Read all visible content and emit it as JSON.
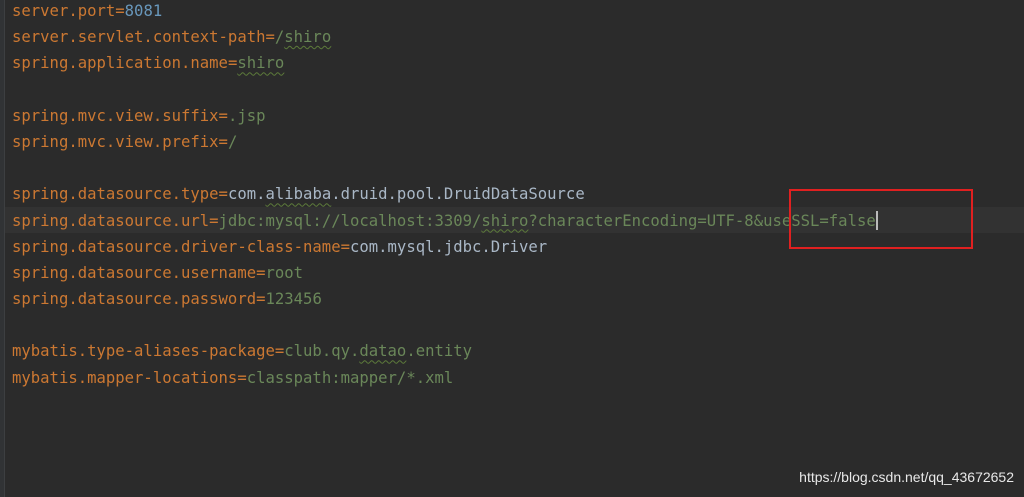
{
  "editor": {
    "lines": [
      {
        "key": "server.port",
        "eq": "=",
        "value": "8081",
        "type": "number"
      },
      {
        "key": "server.servlet.context-path",
        "eq": "=",
        "value_prefix": "/",
        "value_spell": "shiro",
        "type": "green"
      },
      {
        "key": "spring.application.name",
        "eq": "=",
        "value_spell": "shiro",
        "type": "green"
      },
      {
        "key": "spring.mvc.view.suffix",
        "eq": "=",
        "value": ".jsp",
        "type": "green"
      },
      {
        "key": "spring.mvc.view.prefix",
        "eq": "=",
        "value": "/",
        "type": "green"
      },
      {
        "key": "spring.datasource.type",
        "eq": "=",
        "value_a": "com.",
        "value_spell": "alibaba",
        "value_b": ".druid.pool.DruidDataSource",
        "type": "plain"
      },
      {
        "key": "spring.datasource.url",
        "eq": "=",
        "value_a": "jdbc:mysql://localhost:3309/",
        "value_spell": "shiro",
        "value_b": "?characterEncoding=UTF-8&useSSL=false",
        "type": "green"
      },
      {
        "key": "spring.datasource.driver-class-name",
        "eq": "=",
        "value": "com.mysql.jdbc.Driver",
        "type": "plain"
      },
      {
        "key": "spring.datasource.username",
        "eq": "=",
        "value": "root",
        "type": "green"
      },
      {
        "key": "spring.datasource.password",
        "eq": "=",
        "value": "123456",
        "type": "green"
      },
      {
        "key": "mybatis.type-aliases-package",
        "eq": "=",
        "value_a": "club.qy.",
        "value_spell": "datao",
        "value_b": ".entity",
        "type": "green"
      },
      {
        "key": "mybatis.mapper-locations",
        "eq": "=",
        "value": "classpath:mapper/*.xml",
        "type": "green"
      }
    ]
  },
  "watermark": "https://blog.csdn.net/qq_43672652",
  "colors": {
    "background": "#2b2b2b",
    "key": "#cc7832",
    "string": "#6a8759",
    "plain": "#a9b7c6",
    "number": "#6897bb",
    "annotation_box": "#e02020"
  }
}
